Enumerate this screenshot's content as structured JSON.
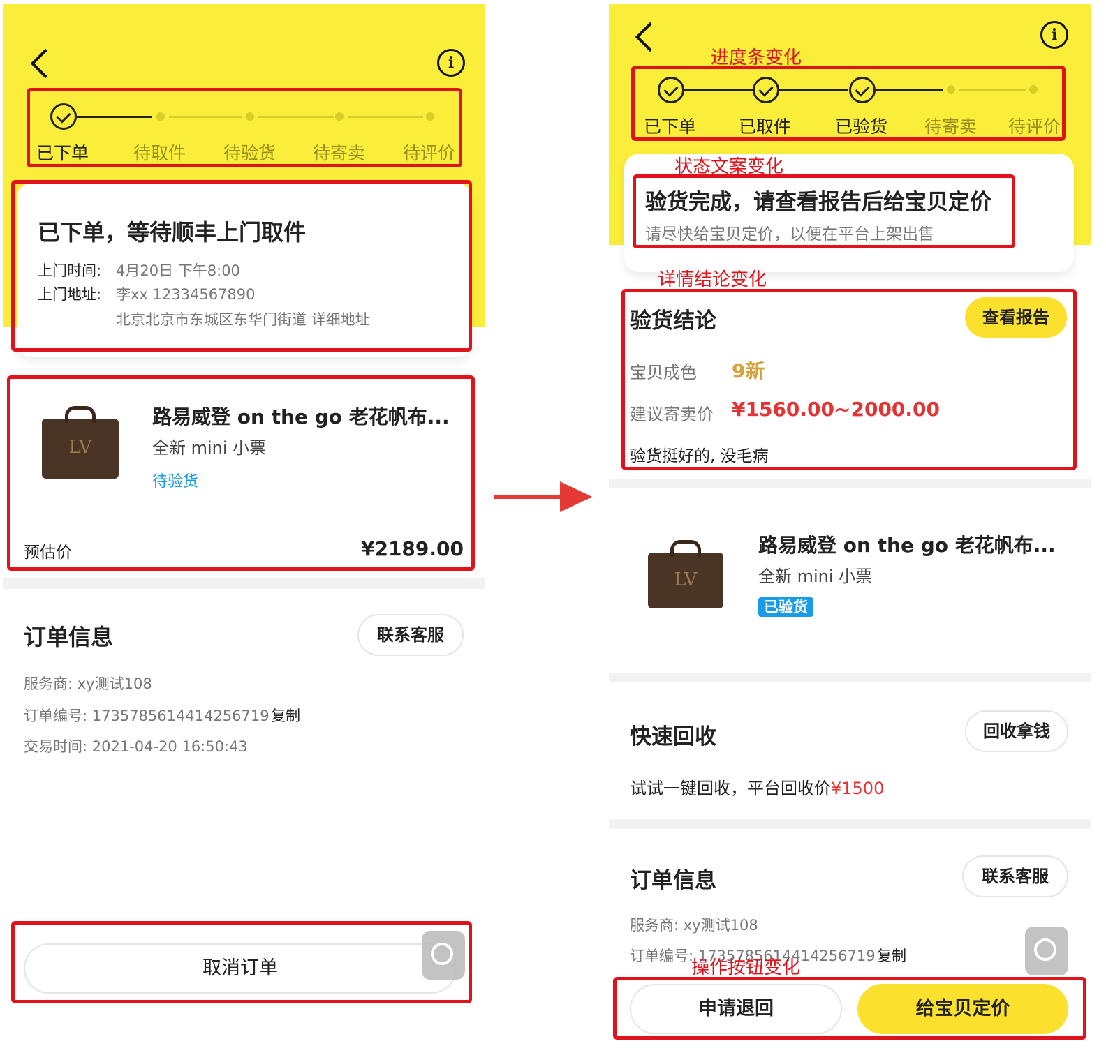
{
  "left": {
    "steps": [
      "已下单",
      "待取件",
      "待验货",
      "待寄卖",
      "待评价"
    ],
    "status_title": "已下单，等待顺丰上门取件",
    "pickup_time_label": "上门时间:",
    "pickup_time": "4月20日 下午8:00",
    "pickup_address_label": "上门地址:",
    "pickup_contact": "李xx 12334567890",
    "pickup_address": "北京北京市东城区东华门街道 详细地址",
    "product_title": "路易威登 on the go 老花帆布...",
    "product_subtitle": "全新 mini 小票",
    "product_status": "待验货",
    "estimate_label": "预估价",
    "estimate_value": "¥2189.00",
    "order_title": "订单信息",
    "contact_button": "联系客服",
    "provider": "服务商: xy测试108",
    "order_number": "订单编号: 1735785614414256719",
    "copy": "复制",
    "trade_time": "交易时间: 2021-04-20 16:50:43",
    "cancel_button": "取消订单"
  },
  "right": {
    "steps": [
      "已下单",
      "已取件",
      "已验货",
      "待寄卖",
      "待评价"
    ],
    "status_title": "验货完成，请查看报告后给宝贝定价",
    "status_subtitle": "请尽快给宝贝定价，以便在平台上架出售",
    "conclusion_title": "验货结论",
    "report_button": "查看报告",
    "condition_label": "宝贝成色",
    "condition_value": "9新",
    "suggest_label": "建议寄卖价",
    "suggest_value": "¥1560.00~2000.00",
    "conclusion_note": "验货挺好的, 没毛病",
    "product_title": "路易威登 on the go 老花帆布...",
    "product_subtitle": "全新 mini 小票",
    "product_status": "已验货",
    "recycle_title": "快速回收",
    "recycle_button": "回收拿钱",
    "recycle_text": "试试一键回收，平台回收价",
    "recycle_price": "¥1500",
    "order_title": "订单信息",
    "contact_button": "联系客服",
    "provider": "服务商: xy测试108",
    "order_number": "订单编号: 1735785614414256719",
    "copy": "复制",
    "return_button": "申请退回",
    "price_button": "给宝贝定价"
  },
  "annotations": {
    "progress": "进度条变化",
    "status_text": "状态文案变化",
    "detail": "详情结论变化",
    "buttons": "操作按钮变化"
  },
  "colors": {
    "yellow": "#fbee3a",
    "red_annotation": "#e0121b",
    "price_red": "#e63232",
    "accent_blue": "#1a9be6"
  },
  "icons": [
    "back-icon",
    "info-icon",
    "check-icon",
    "tool-icon",
    "arrow-right-icon"
  ]
}
